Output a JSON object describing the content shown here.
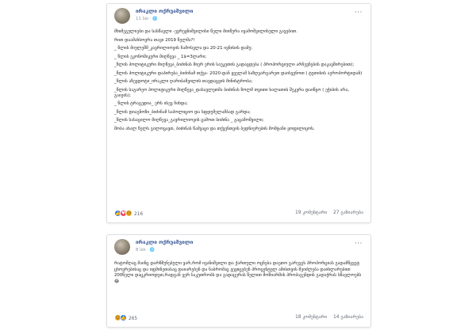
{
  "post1": {
    "author": "ირაკლი ოქრუაშვილი",
    "time": "11 სთ",
    "privacy_icon": "globe-icon",
    "menu_label": "···",
    "lines": [
      "მხიმეგულიები და სასწავლი -ევრეყნიშვილისი წელი მიიწურა ივამოშვილისული გავებით.",
      "რით დაამახსოვრა თავი 2019 წელმა?!",
      "_ წლის მიულეშმ_კავრილიოვის ჩამოსვლა და 20-21 ივნისის დამე;",
      "_ წლის ეკონომიკური მიღწევა _ 1$=3ლარი;",
      "_წლის პოლიტიკური მიღწევა_ბიძინას მიერ ერის საუკეთის გადაცდება ( პროპორციული არჩევნების დაკავშირებით);",
      "_წლის პოლიტიკური დაპირება_ბიძინამ თქვა- 2020-დან ყველამ საზღვარგარეთ დაისვენოთ ( ტუთისის აეროპორტიდან)",
      "_წლის აზევდოტი_ირაკლი ღარიბაშვილის თავდაცვის მინისტრობა;",
      "_წლის საგარეო პოლიტიკური მიღწევა_დასავლეთმა ბიძინას ზოლმ თვითი ხალათის შეკვრა დაიწყო ( ეჭიბის არა, გაიეის);",
      "_ წლის ტრაგედია_ ერს ისევ ჩიხდა;",
      "_წლის დიაგნოზი_ბიძინამ საპოლიციო და სფდუმელამბად გარდა;",
      "_წლის სასაცილო მიღწევა_გავრილიოვის ცამოთ ბიძინა _ გაცამოშვილი;",
      "შობა ახალ წელს გილოცავთ, ბიძინას წამვაცი და თქვენთვის ბედნიერების მომტანი ყოფილიყოს."
    ],
    "reaction_icons": [
      "like-icon",
      "love-icon",
      "sad-icon"
    ],
    "reaction_count": "216",
    "comments": "19 კომენტარი",
    "shares": "27 გაზიარება"
  },
  "post2": {
    "author": "ირაკლი ოქრუაშვილი",
    "time": "8 სთ",
    "privacy_icon": "globe-icon",
    "menu_label": "···",
    "text": "რატომღაც მაინც დარწმუნებული ვარ,რომ ივანიშვილი და ქართული ოცნება დაეთო გარევეს პროპორციას გადამწყვეტ ცხოვრებისაც და იფმინეთასაც დაიარებენ და ნაბრომაც ვეყიცებენ პროცენტულ ამისთვის შეიძლება დაიხლარებით 200წელი დაცკრიოდეთ,რადგან ვერ საკუთრობს და გადაცერას წელით მოშიარმის პროპაგენდის გადაჭრას სწავლოებს 😂",
    "reaction_icons": [
      "haha-icon",
      "like-icon"
    ],
    "reaction_count": "265",
    "comments": "18 კომენტარი",
    "shares": "14 გაზიარება"
  },
  "colors": {
    "author": "#385898",
    "meta": "#90949c",
    "like": "#2078f4",
    "love": "#f33e58",
    "sad": "#f7b125"
  }
}
